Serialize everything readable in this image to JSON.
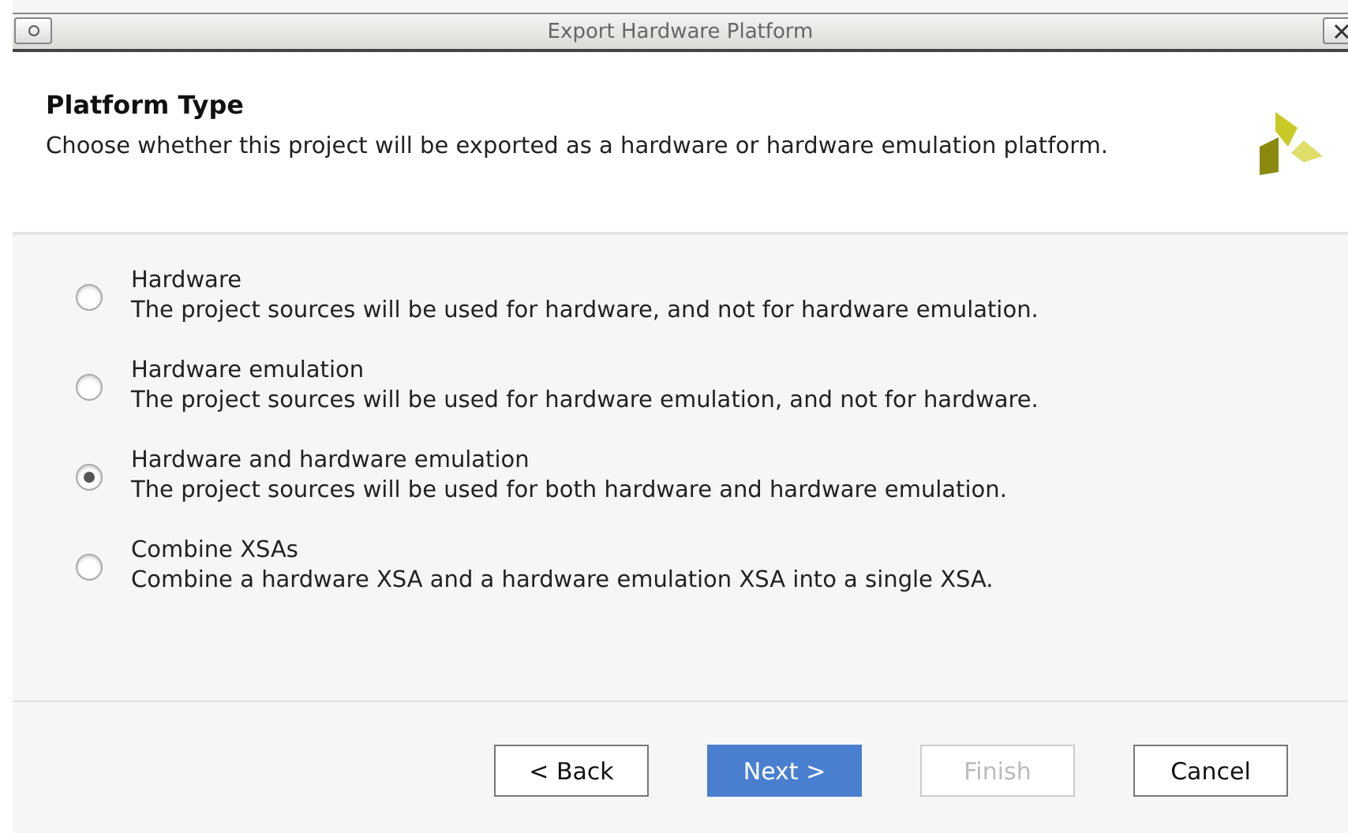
{
  "window": {
    "title": "Export Hardware Platform"
  },
  "header": {
    "title": "Platform Type",
    "description": "Choose whether this project will be exported as a hardware or hardware emulation platform."
  },
  "options": [
    {
      "label": "Hardware",
      "description": "The project sources will be used for hardware, and not for hardware emulation.",
      "selected": false
    },
    {
      "label": "Hardware emulation",
      "description": "The project sources will be used for hardware emulation, and not for hardware.",
      "selected": false
    },
    {
      "label": "Hardware and hardware emulation",
      "description": "The project sources will be used for both hardware and hardware emulation.",
      "selected": true
    },
    {
      "label": "Combine XSAs",
      "description": "Combine a hardware XSA and a hardware emulation XSA into a single XSA.",
      "selected": false
    }
  ],
  "buttons": [
    {
      "label": "< Back",
      "kind": "normal",
      "disabled": false
    },
    {
      "label": "Next >",
      "kind": "default",
      "disabled": false
    },
    {
      "label": "Finish",
      "kind": "normal",
      "disabled": true
    },
    {
      "label": "Cancel",
      "kind": "normal",
      "disabled": false
    }
  ]
}
